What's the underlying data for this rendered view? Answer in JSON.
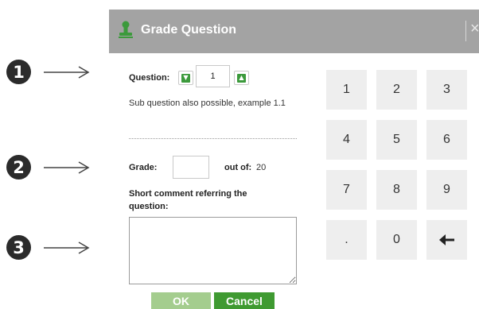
{
  "callouts": [
    "❶",
    "❷",
    "❸"
  ],
  "dialog": {
    "title": "Grade Question",
    "close_glyph": "✕",
    "question_label": "Question:",
    "question_value": "1",
    "down_glyph": "⬇",
    "up_glyph": "⬆",
    "sub_question_hint": "Sub question also possible, example 1.1",
    "grade_label": "Grade:",
    "grade_value": "",
    "out_of_label": "out of:",
    "out_of_value": "20",
    "comment_label": "Short comment referring the question:",
    "comment_value": "",
    "ok_label": "OK",
    "cancel_label": "Cancel",
    "keypad": [
      "1",
      "2",
      "3",
      "4",
      "5",
      "6",
      "7",
      "8",
      "9",
      ".",
      "0",
      "🡐"
    ]
  },
  "colors": {
    "titlebar": "#a3a3a3",
    "ok_button": "#a4cd8e",
    "cancel_button": "#3f9a31",
    "keypad_key": "#eeeeee",
    "icon_green": "#3c9a3c"
  }
}
